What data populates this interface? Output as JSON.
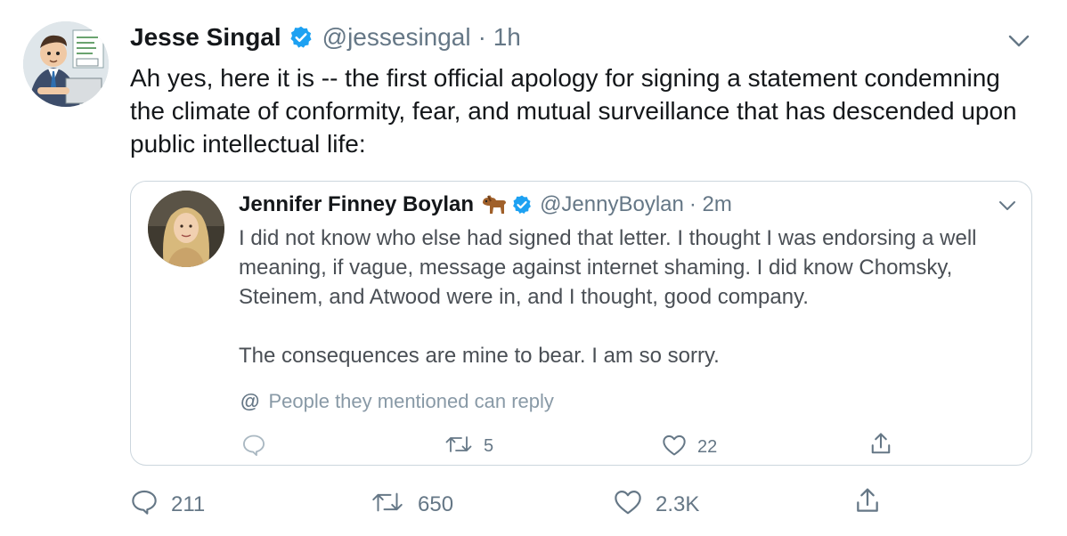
{
  "tweet": {
    "author_name": "Jesse Singal",
    "handle": "@jessesingal",
    "time": "· 1h",
    "text": "Ah yes, here it is -- the first official apology for signing a statement condemning the climate of conformity, fear, and mutual surveillance that has descended upon public intellectual life:",
    "actions": {
      "replies": "211",
      "retweets": "650",
      "likes": "2.3K"
    }
  },
  "quoted_tweet": {
    "author_name": "Jennifer Finney Boylan",
    "handle": "@JennyBoylan",
    "time": "· 2m",
    "paragraph_1": "I did not know who else had signed that letter.  I thought I was endorsing a well meaning, if vague, message against internet shaming.  I did know Chomsky, Steinem, and Atwood were in, and I thought, good company.",
    "paragraph_2": "The consequences are mine to bear. I am so sorry.",
    "mention_icon": "@",
    "mention_note": "People they mentioned can reply",
    "actions": {
      "retweets": "5",
      "likes": "22"
    }
  },
  "colors": {
    "accent": "#1da1f2",
    "muted": "#657786",
    "border": "#ccd6dd"
  },
  "icons": [
    "verified-badge-icon",
    "chevron-down-icon",
    "dog-emoji-icon",
    "reply-icon",
    "retweet-icon",
    "like-icon",
    "share-icon",
    "at-icon"
  ]
}
